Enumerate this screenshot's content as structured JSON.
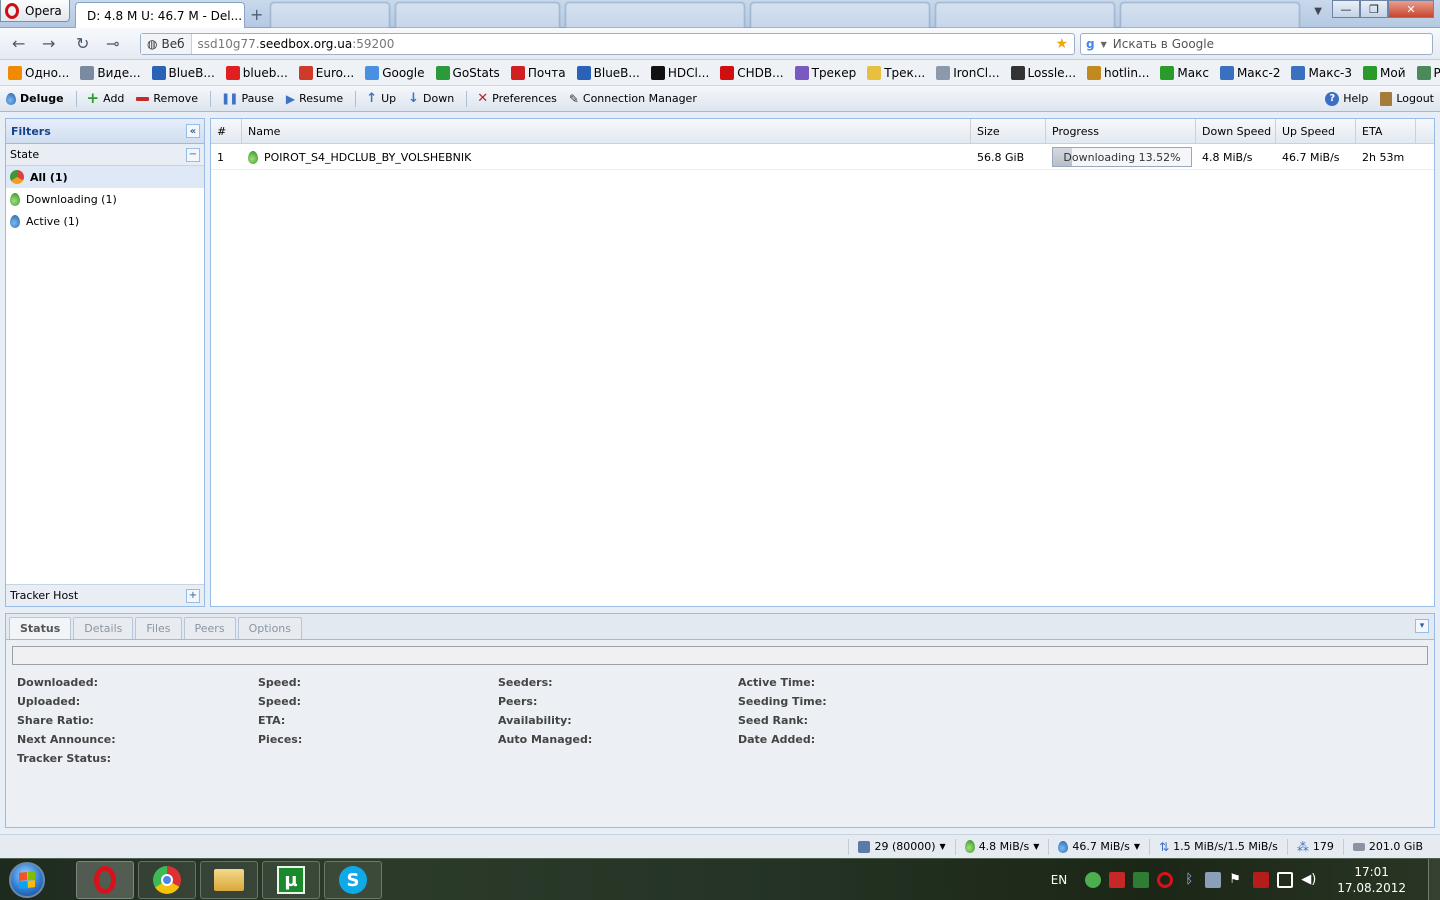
{
  "opera": {
    "menu_label": "Opera"
  },
  "tabs": {
    "active_title": "D: 4.8 M U: 46.7 M - Del...",
    "new_tab": "+"
  },
  "window": {
    "minimize": "—",
    "restore": "❐",
    "close": "✕"
  },
  "address": {
    "badge": "Веб",
    "url_prefix": "ssd10g77.",
    "url_domain": "seedbox.org.ua",
    "url_suffix": ":59200",
    "search_placeholder": "Искать в Google"
  },
  "bookmarks": [
    {
      "label": "Одно...",
      "color": "#f08a00"
    },
    {
      "label": "Виде...",
      "color": "#7a8aa0"
    },
    {
      "label": "BlueB...",
      "color": "#2a62b8"
    },
    {
      "label": "blueb...",
      "color": "#e02020"
    },
    {
      "label": "Euro...",
      "color": "#d03a2a"
    },
    {
      "label": "Google",
      "color": "#4a90e2"
    },
    {
      "label": "GoStats",
      "color": "#2a9a3a"
    },
    {
      "label": "Почта",
      "color": "#d02020"
    },
    {
      "label": "BlueB...",
      "color": "#2a62b8"
    },
    {
      "label": "HDCl...",
      "color": "#111111"
    },
    {
      "label": "CHDB...",
      "color": "#d01010"
    },
    {
      "label": "Трекер",
      "color": "#7a5ac0"
    },
    {
      "label": "Трек...",
      "color": "#e8c040"
    },
    {
      "label": "IronCl...",
      "color": "#8a9aaa"
    },
    {
      "label": "Lossle...",
      "color": "#333333"
    },
    {
      "label": "hotlin...",
      "color": "#c08a20"
    },
    {
      "label": "Макс",
      "color": "#2a9a2a"
    },
    {
      "label": "Макс-2",
      "color": "#3a70c0"
    },
    {
      "label": "Макс-3",
      "color": "#3a70c0"
    },
    {
      "label": "Мой",
      "color": "#2a9a2a"
    },
    {
      "label": "Pictur...",
      "color": "#4a8a5a"
    }
  ],
  "toolbar": {
    "app_name": "Deluge",
    "add": "Add",
    "remove": "Remove",
    "pause": "Pause",
    "resume": "Resume",
    "up": "Up",
    "down": "Down",
    "preferences": "Preferences",
    "connection_manager": "Connection Manager",
    "help": "Help",
    "logout": "Logout"
  },
  "sidebar": {
    "title": "Filters",
    "state_label": "State",
    "states": [
      {
        "label": "All (1)"
      },
      {
        "label": "Downloading (1)"
      },
      {
        "label": "Active (1)"
      }
    ],
    "tracker_label": "Tracker Host"
  },
  "grid": {
    "columns": [
      "#",
      "Name",
      "Size",
      "Progress",
      "Down Speed",
      "Up Speed",
      "ETA"
    ],
    "rows": [
      {
        "index": "1",
        "name": "POIROT_S4_HDCLUB_BY_VOLSHEBNIK",
        "size": "56.8 GiB",
        "progress_text": "Downloading 13.52%",
        "progress_fraction": 0.1352,
        "down_speed": "4.8 MiB/s",
        "up_speed": "46.7 MiB/s",
        "eta": "2h 53m"
      }
    ]
  },
  "details": {
    "tabs": [
      "Status",
      "Details",
      "Files",
      "Peers",
      "Options"
    ],
    "col1": [
      "Downloaded:",
      "Uploaded:",
      "Share Ratio:",
      "Next Announce:",
      "Tracker Status:"
    ],
    "col2": [
      "Speed:",
      "Speed:",
      "ETA:",
      "Pieces:"
    ],
    "col3": [
      "Seeders:",
      "Peers:",
      "Availability:",
      "Auto Managed:"
    ],
    "col4": [
      "Active Time:",
      "Seeding Time:",
      "Seed Rank:",
      "Date Added:"
    ]
  },
  "statusbar": {
    "connections": "29 (80000)",
    "download": "4.8 MiB/s",
    "upload": "46.7 MiB/s",
    "protocol": "1.5 MiB/s/1.5 MiB/s",
    "dht": "179",
    "free_space": "201.0 GiB"
  },
  "taskbar": {
    "language": "EN",
    "time": "17:01",
    "date": "17.08.2012"
  }
}
